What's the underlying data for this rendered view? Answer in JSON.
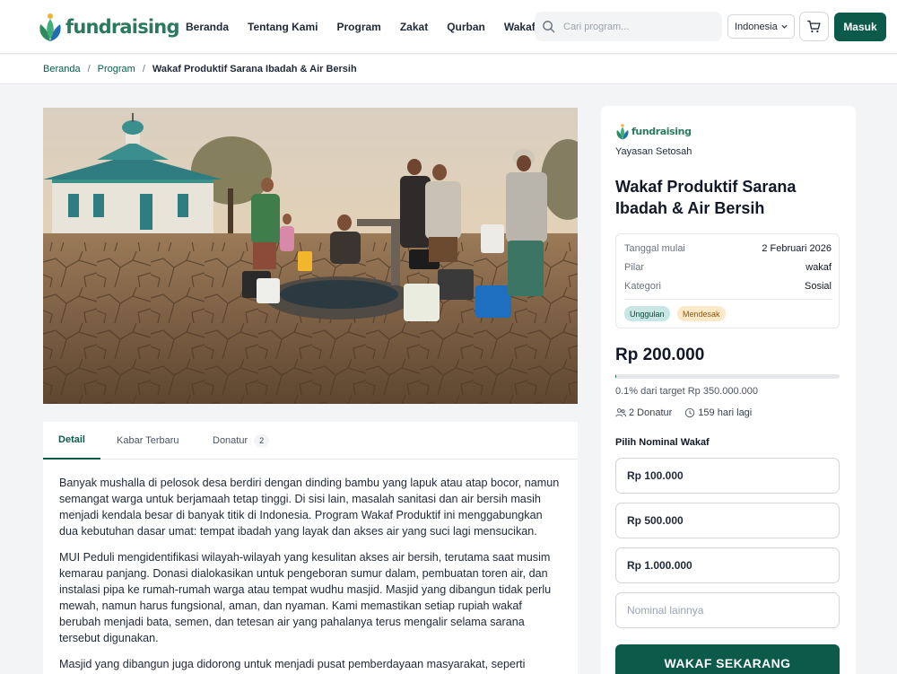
{
  "header": {
    "logo_text": "fundraising",
    "nav": [
      "Beranda",
      "Tentang Kami",
      "Program",
      "Zakat",
      "Qurban",
      "Wakaf"
    ],
    "search_placeholder": "Cari program...",
    "language": "Indonesia",
    "login_label": "Masuk"
  },
  "breadcrumb": {
    "home": "Beranda",
    "section": "Program",
    "current": "Wakaf Produktif Sarana Ibadah & Air Bersih"
  },
  "tabs": [
    {
      "label": "Detail"
    },
    {
      "label": "Kabar Terbaru"
    },
    {
      "label": "Donatur",
      "badge": "2"
    }
  ],
  "content": {
    "paragraphs": [
      "Banyak mushalla di pelosok desa berdiri dengan dinding bambu yang lapuk atau atap bocor, namun semangat warga untuk berjamaah tetap tinggi. Di sisi lain, masalah sanitasi dan air bersih masih menjadi kendala besar di banyak titik di Indonesia. Program Wakaf Produktif ini menggabungkan dua kebutuhan dasar umat: tempat ibadah yang layak dan akses air yang suci lagi mensucikan.",
      "MUI Peduli mengidentifikasi wilayah-wilayah yang kesulitan akses air bersih, terutama saat musim kemarau panjang. Donasi dialokasikan untuk pengeboran sumur dalam, pembuatan toren air, dan instalasi pipa ke rumah-rumah warga atau tempat wudhu masjid. Masjid yang dibangun tidak perlu mewah, namun harus fungsional, aman, dan nyaman. Kami memastikan setiap rupiah wakaf berubah menjadi bata, semen, dan tetesan air yang pahalanya terus mengalir selama sarana tersebut digunakan.",
      "Masjid yang dibangun juga didorong untuk menjadi pusat pemberdayaan masyarakat, seperti"
    ]
  },
  "sidebar": {
    "org_logo_text": "fundraising",
    "org_name": "Yayasan Setosah",
    "title": "Wakaf Produktif Sarana Ibadah & Air Bersih",
    "info": [
      {
        "label": "Tanggal mulai",
        "value": "2 Februari 2026"
      },
      {
        "label": "Pilar",
        "value": "wakaf"
      },
      {
        "label": "Kategori",
        "value": "Sosial"
      }
    ],
    "tags": [
      "Unggulan",
      "Mendesak"
    ],
    "amount": "Rp 200.000",
    "progress_fraction": 0.001,
    "target_text": "0.1% dari target Rp 350.000.000",
    "donors": "2 Donatur",
    "days_left": "159 hari lagi",
    "pick_label": "Pilih Nominal Wakaf",
    "options": [
      "Rp 100.000",
      "Rp 500.000",
      "Rp 1.000.000"
    ],
    "other_placeholder": "Nominal lainnya",
    "cta_label": "WAKAF SEKARANG"
  },
  "colors": {
    "primary": "#0c5a4a",
    "logo_green": "#2b7a5e",
    "tag_unggulan_bg": "#c7e6e4",
    "tag_mendesak_bg": "#fde8c8"
  }
}
